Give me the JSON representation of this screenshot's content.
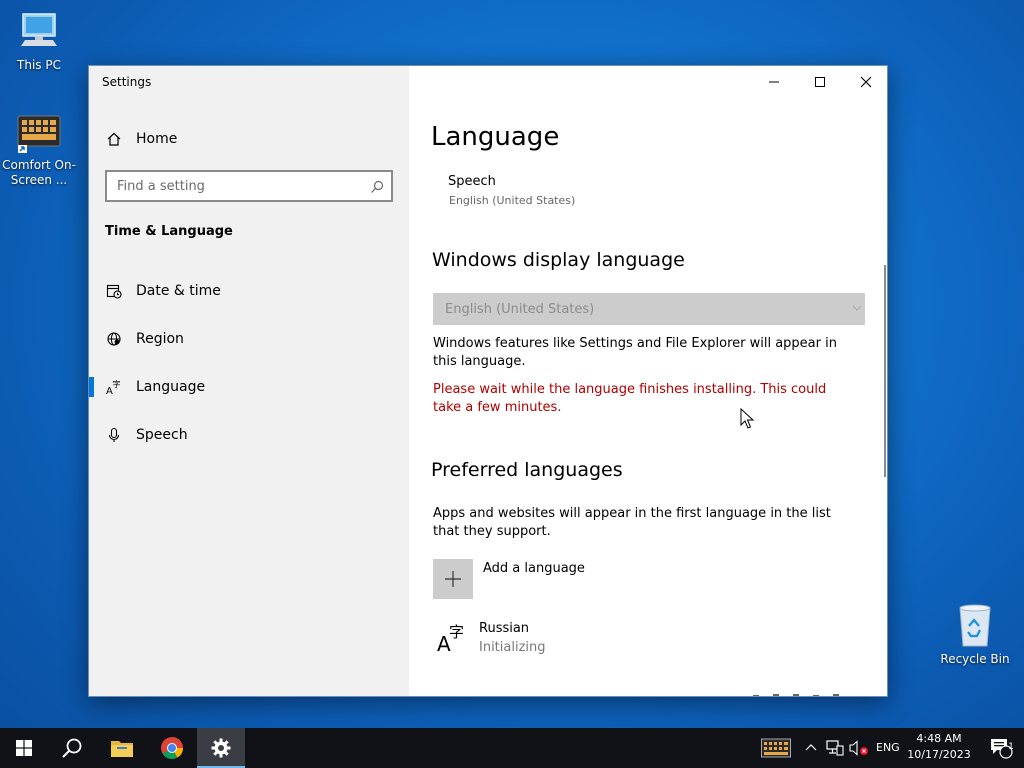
{
  "desktop": {
    "icons": [
      {
        "label": "This PC"
      },
      {
        "label": "Comfort On-Screen ..."
      },
      {
        "label": "Recycle Bin"
      }
    ]
  },
  "window": {
    "title": "Settings",
    "captions": {
      "minimize": "minimize",
      "maximize": "maximize",
      "close": "close"
    }
  },
  "sidebar": {
    "home_label": "Home",
    "search_placeholder": "Find a setting",
    "section_title": "Time & Language",
    "items": [
      {
        "label": "Date & time",
        "icon": "calendar-clock-icon"
      },
      {
        "label": "Region",
        "icon": "globe-icon"
      },
      {
        "label": "Language",
        "icon": "language-icon",
        "active": true
      },
      {
        "label": "Speech",
        "icon": "microphone-icon"
      }
    ]
  },
  "content": {
    "page_title": "Language",
    "speech": {
      "title": "Speech",
      "subtitle": "English (United States)"
    },
    "display_language": {
      "heading": "Windows display language",
      "selected": "English (United States)",
      "description": "Windows features like Settings and File Explorer will appear in this language.",
      "warning": "Please wait while the language finishes installing. This could take a few minutes."
    },
    "preferred": {
      "heading": "Preferred languages",
      "description": "Apps and websites will appear in the first language in the list that they support.",
      "add_label": "Add a language",
      "languages": [
        {
          "name": "Russian",
          "status": "Initializing"
        }
      ]
    }
  },
  "taskbar": {
    "tray_language": "ENG",
    "clock_time": "4:48 AM",
    "clock_date": "10/17/2023",
    "notification_count": "1",
    "accent": "#0078d7"
  }
}
